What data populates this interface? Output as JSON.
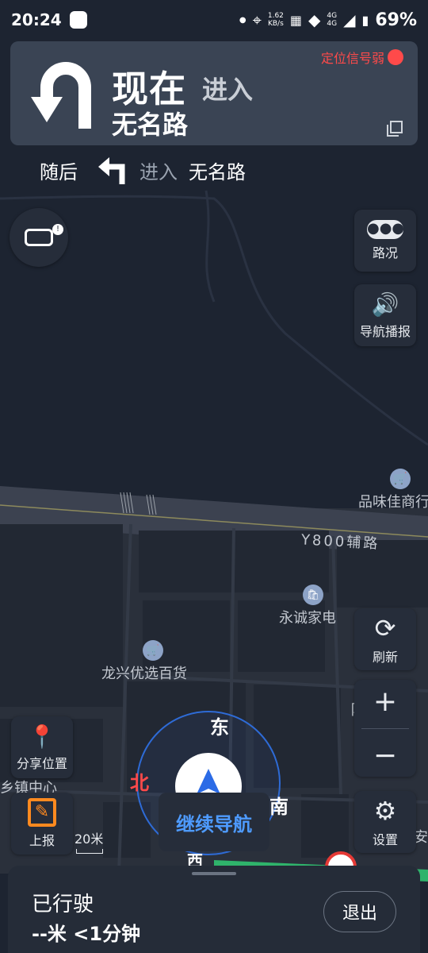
{
  "status_bar": {
    "time": "20:24",
    "speed_value": "1.62",
    "speed_unit": "KB/s",
    "net1": "4G",
    "net2": "4G",
    "battery": "69%"
  },
  "guidance": {
    "signal_text": "定位信号弱",
    "now": "现在",
    "enter": "进入",
    "road": "无名路",
    "turn_icon": "u-turn-left-icon"
  },
  "next_step": {
    "then": "随后",
    "enter": "进入",
    "road": "无名路",
    "turn_icon": "turn-left-icon"
  },
  "map_labels": {
    "poi_1": "品味佳商行",
    "road_1": "Y800辅路",
    "poi_2": "永诚家电",
    "poi_3": "龙兴优选百货",
    "poi_4": "乡镇中心",
    "poi_5": "安",
    "poi_6": "阝"
  },
  "buttons": {
    "traffic": "路况",
    "voice": "导航播报",
    "refresh": "刷新",
    "share": "分享位置",
    "report": "上报",
    "settings": "设置",
    "continue_nav": "继续导航",
    "exit": "退出"
  },
  "compass": {
    "east": "东",
    "north": "北",
    "south": "南",
    "west": "西"
  },
  "scale_label": "20米",
  "trip": {
    "traveled_label": "已行驶",
    "summary": "--米 <1分钟"
  },
  "colors": {
    "accent_blue": "#4e9bff",
    "warning_red": "#ff4a4a",
    "report_orange": "#ff8a1f",
    "route_green": "#2fb36b"
  }
}
